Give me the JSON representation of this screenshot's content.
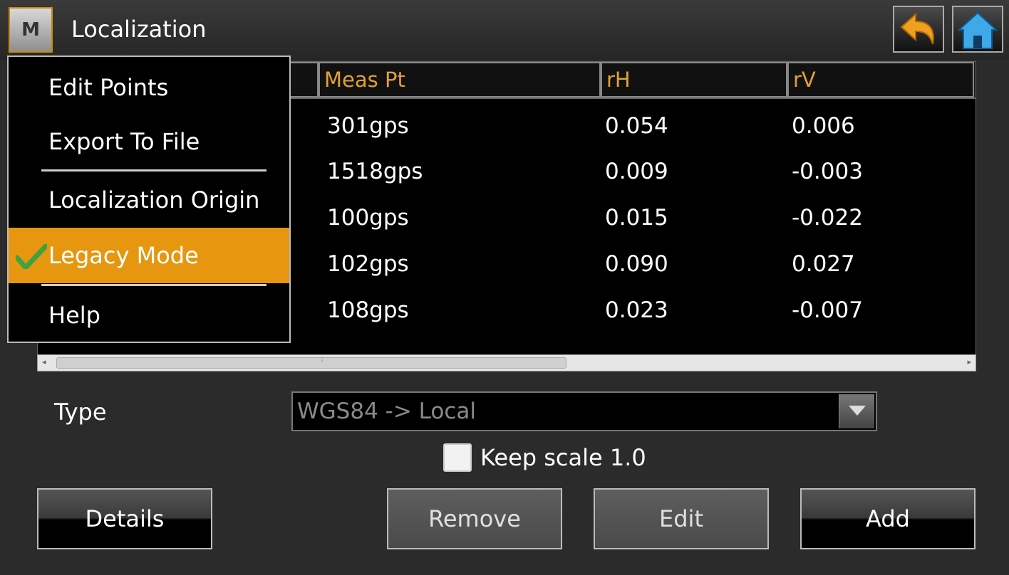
{
  "header": {
    "menu_icon_letter": "M",
    "title": "Localization",
    "back_icon": "undo-arrow-icon",
    "home_icon": "home-icon"
  },
  "table": {
    "columns": [
      "Meas Pt",
      "rH",
      "rV"
    ],
    "rows": [
      {
        "meas_pt": "301gps",
        "rh": "0.054",
        "rv": "0.006"
      },
      {
        "meas_pt": "1518gps",
        "rh": "0.009",
        "rv": "-0.003"
      },
      {
        "meas_pt": "100gps",
        "rh": "0.015",
        "rv": "-0.022"
      },
      {
        "meas_pt": "102gps",
        "rh": "0.090",
        "rv": "0.027"
      },
      {
        "meas_pt": "108gps",
        "rh": "0.023",
        "rv": "-0.007"
      }
    ]
  },
  "menu": {
    "items": [
      {
        "label": "Edit Points"
      },
      {
        "label": "Export To File"
      },
      {
        "label": "Localization Origin"
      },
      {
        "label": "Legacy Mode",
        "checked": true
      },
      {
        "label": "Help"
      }
    ]
  },
  "form": {
    "type_label": "Type",
    "type_value": "WGS84 -> Local",
    "keep_scale_label": "Keep scale 1.0",
    "keep_scale_checked": false
  },
  "buttons": {
    "details": "Details",
    "remove": "Remove",
    "edit": "Edit",
    "add": "Add"
  },
  "colors": {
    "accent": "#e6960f",
    "header_text": "#e2a034",
    "background": "#2b2b2b"
  }
}
